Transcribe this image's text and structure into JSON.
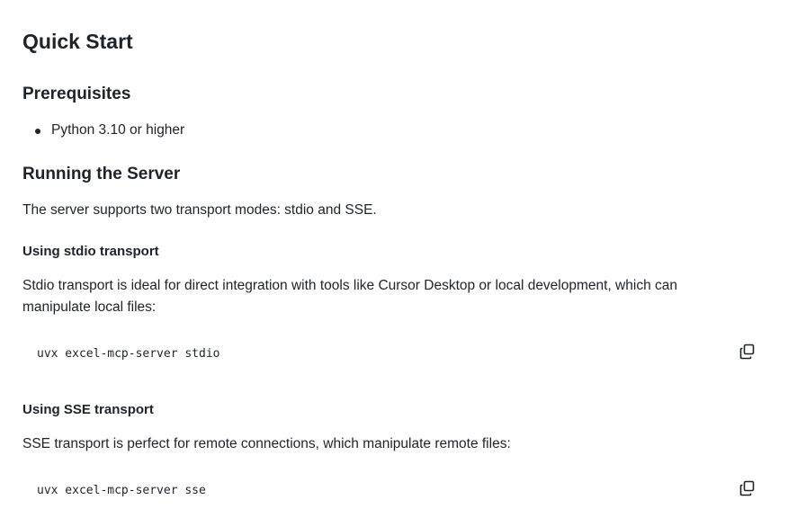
{
  "doc": {
    "top_cut_text": "",
    "quick_start_heading": "Quick Start",
    "prerequisites_heading": "Prerequisites",
    "prerequisites_items": [
      "Python 3.10 or higher"
    ],
    "running_heading": "Running the Server",
    "running_intro": "The server supports two transport modes: stdio and SSE.",
    "stdio_heading": "Using stdio transport",
    "stdio_desc_line1": "Stdio transport is ideal for direct integration with tools like Cursor Desktop or local development, which can",
    "stdio_desc_line2": "manipulate local files:",
    "stdio_command": "uvx excel-mcp-server stdio",
    "sse_heading": "Using SSE transport",
    "sse_desc": "SSE transport is perfect for remote connections, which manipulate remote files:",
    "sse_command": "uvx excel-mcp-server sse"
  },
  "icons": {
    "copy": "copy-icon"
  }
}
